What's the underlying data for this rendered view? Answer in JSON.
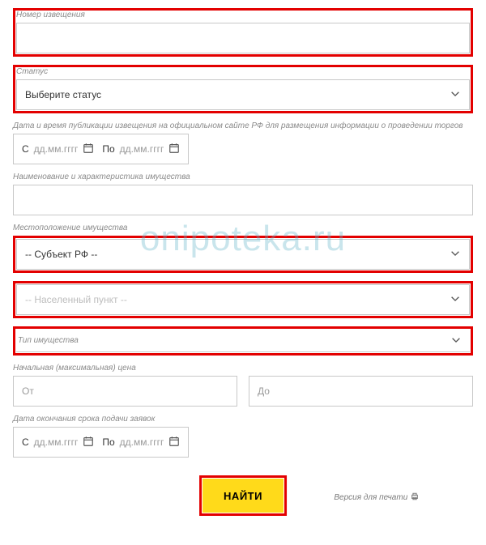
{
  "watermark": "onipoteka.ru",
  "notice_number": {
    "label": "Номер извещения",
    "value": ""
  },
  "status": {
    "label": "Статус",
    "placeholder": "Выберите статус"
  },
  "publication_date": {
    "label": "Дата и время публикации извещения на официальном сайте РФ для размещения информации о проведении торгов",
    "from_prefix": "С",
    "to_prefix": "По",
    "placeholder": "дд.мм.гггг"
  },
  "property_name": {
    "label": "Наименование и характеристика имущества",
    "value": ""
  },
  "location": {
    "label": "Местоположение имущества",
    "region_placeholder": "-- Субъект РФ --",
    "city_placeholder": "-- Населенный пункт --"
  },
  "property_type": {
    "label": "Тип имущества"
  },
  "price": {
    "label": "Начальная (максимальная) цена",
    "from_placeholder": "От",
    "to_placeholder": "До"
  },
  "deadline": {
    "label": "Дата окончания срока подачи заявок",
    "from_prefix": "С",
    "to_prefix": "По",
    "placeholder": "дд.мм.гггг"
  },
  "submit": {
    "label": "НАЙТИ"
  },
  "print": {
    "label": "Версия для печати"
  }
}
